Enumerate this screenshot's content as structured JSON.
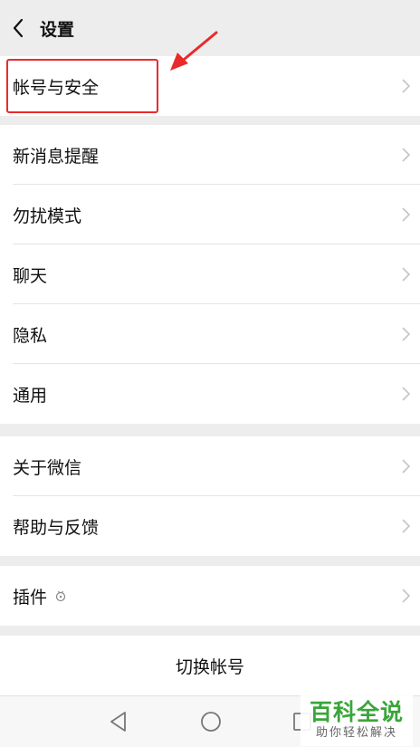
{
  "header": {
    "title": "设置"
  },
  "groups": [
    {
      "items": [
        {
          "label": "帐号与安全"
        }
      ]
    },
    {
      "items": [
        {
          "label": "新消息提醒"
        },
        {
          "label": "勿扰模式"
        },
        {
          "label": "聊天"
        },
        {
          "label": "隐私"
        },
        {
          "label": "通用"
        }
      ]
    },
    {
      "items": [
        {
          "label": "关于微信"
        },
        {
          "label": "帮助与反馈"
        }
      ]
    },
    {
      "items": [
        {
          "label": "插件"
        }
      ]
    }
  ],
  "switch_account": {
    "label": "切换帐号"
  },
  "watermark": {
    "main": "百科全说",
    "sub": "助你轻松解决"
  },
  "colors": {
    "accent": "#ea2a2a",
    "background": "#ededed",
    "watermark": "#3aa53a"
  },
  "icons": [
    "back-arrow-icon",
    "chevron-right-icon",
    "plugin-badge-icon",
    "nav-back-icon",
    "nav-home-icon",
    "nav-recent-icon",
    "annotation-arrow-icon"
  ]
}
